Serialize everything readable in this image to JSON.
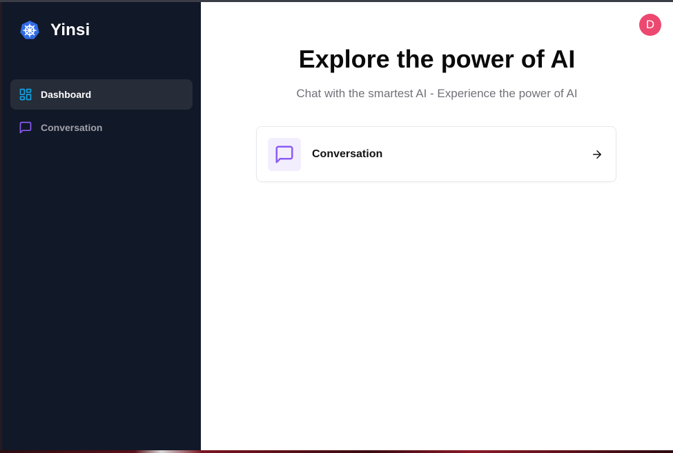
{
  "brand": {
    "name": "Yinsi",
    "logo_icon": "helm-wheel-icon"
  },
  "sidebar": {
    "items": [
      {
        "label": "Dashboard",
        "icon": "layout-dashboard-icon",
        "icon_color": "#0ea5e9",
        "active": true
      },
      {
        "label": "Conversation",
        "icon": "message-square-icon",
        "icon_color": "#8b5cf6",
        "active": false
      }
    ]
  },
  "header": {
    "avatar_initial": "D",
    "avatar_color": "#ec4870"
  },
  "main": {
    "title": "Explore the power of AI",
    "subtitle": "Chat with the smartest AI - Experience the power of AI",
    "tools": [
      {
        "label": "Conversation",
        "icon": "message-square-icon",
        "icon_color": "#8b5cf6",
        "icon_bg": "#f3eefe",
        "action_icon": "arrow-right-icon"
      }
    ]
  },
  "colors": {
    "sidebar_bg": "#111827",
    "active_item_bg": "#262c38",
    "main_bg": "#ffffff"
  }
}
